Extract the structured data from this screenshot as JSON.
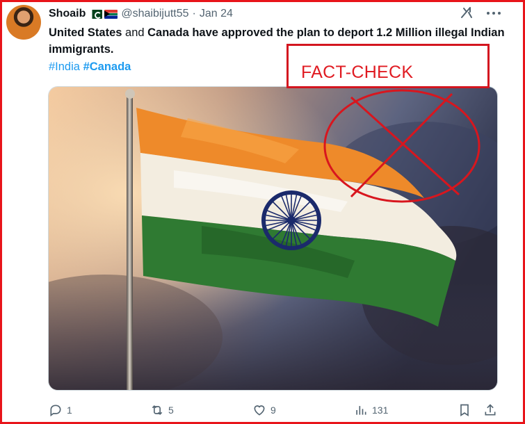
{
  "tweet": {
    "display_name": "Shoaib",
    "handle": "@shaibijutt55",
    "separator": "·",
    "date": "Jan 24",
    "text_parts": {
      "p1": "United States",
      "p2": " and ",
      "p3": "Canada",
      "p4": " have approved the plan to deport 1.2 Million illegal Indian immigrants."
    },
    "hashtags": [
      "#India",
      "#Canada"
    ]
  },
  "annotation": {
    "label": "FACT-CHECK",
    "color": "#e01b22"
  },
  "media": {
    "subject": "indian-flag-waving-against-cloudy-sky"
  },
  "actions": {
    "replies": "1",
    "reposts": "5",
    "likes": "9",
    "views": "131"
  },
  "colors": {
    "link": "#1d9bf0",
    "secondary_text": "#536471",
    "frame_red": "#e8141a",
    "saffron": "#f08a2c",
    "green": "#2f7a32",
    "chakra_navy": "#1b2a6b"
  },
  "icons": [
    "flag-pakistan-icon",
    "flag-south-africa-icon",
    "grok-icon",
    "more-icon",
    "reply-icon",
    "repost-icon",
    "like-icon",
    "views-icon",
    "bookmark-icon",
    "share-icon"
  ]
}
